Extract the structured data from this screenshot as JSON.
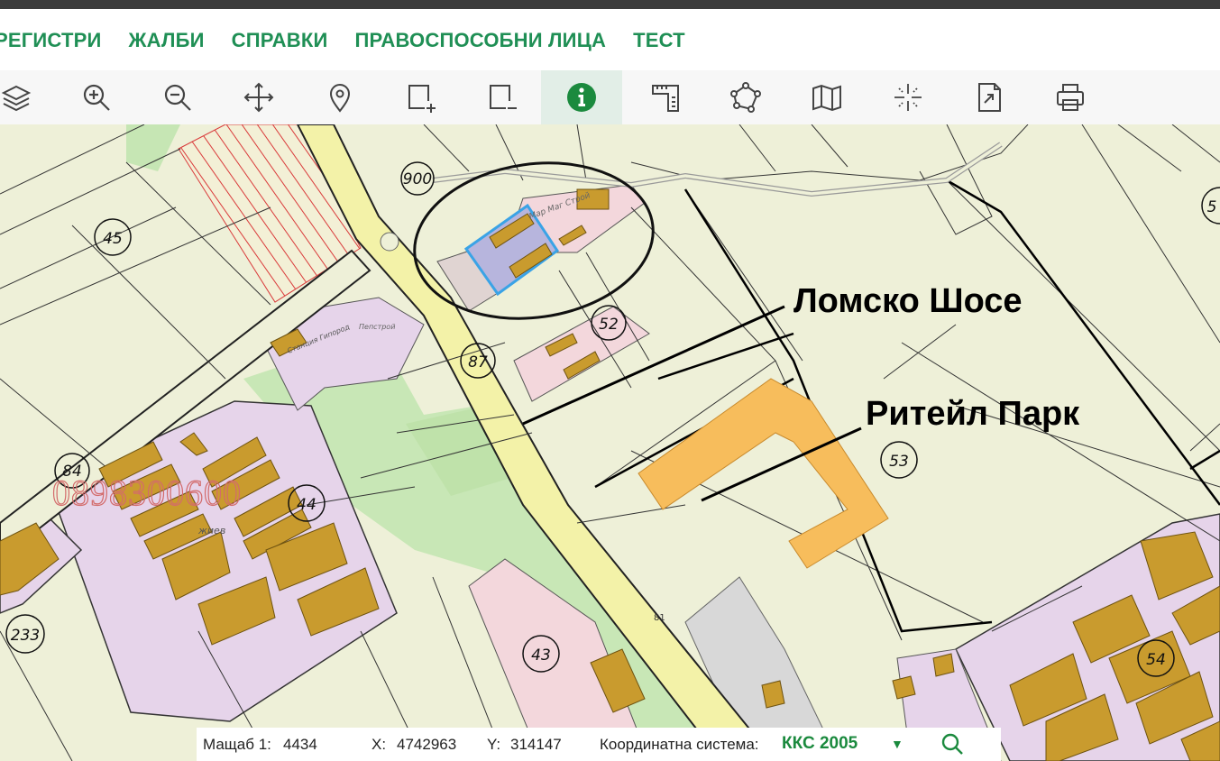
{
  "nav": {
    "items": [
      "РЕГИСТРИ",
      "ЖАЛБИ",
      "СПРАВКИ",
      "ПРАВОСПОСОБНИ ЛИЦА",
      "ТЕСТ"
    ]
  },
  "toolbar": {
    "tools": [
      "layers-icon",
      "zoom-in-icon",
      "zoom-out-icon",
      "pan-icon",
      "location-pin-icon",
      "add-rectangle-icon",
      "remove-rectangle-icon",
      "info-icon",
      "ruler-icon",
      "polygon-icon",
      "map-icon",
      "crosshair-icon",
      "export-icon",
      "print-icon"
    ],
    "active_tool": "info-icon",
    "accent": "#1b8a3e"
  },
  "map": {
    "watermark_phone": "0898300600",
    "parcel_labels": [
      "900",
      "45",
      "52",
      "87",
      "84",
      "44",
      "53",
      "233",
      "43",
      "54",
      "5"
    ],
    "road_label": "81",
    "building_labels": [
      "Мар Маг Строй",
      "Пепстрой",
      "Станция Гипород",
      "жиев"
    ],
    "annotations": {
      "road": "Ломско Шосе",
      "retail": "Ритейл Парк"
    }
  },
  "status": {
    "scale_label": "Мащаб 1:",
    "scale_value": "4434",
    "x_label": "X:",
    "x_value": "4742963",
    "y_label": "Y:",
    "y_value": "314147",
    "crs_label": "Координатна система:",
    "crs_value": "ККС 2005"
  }
}
